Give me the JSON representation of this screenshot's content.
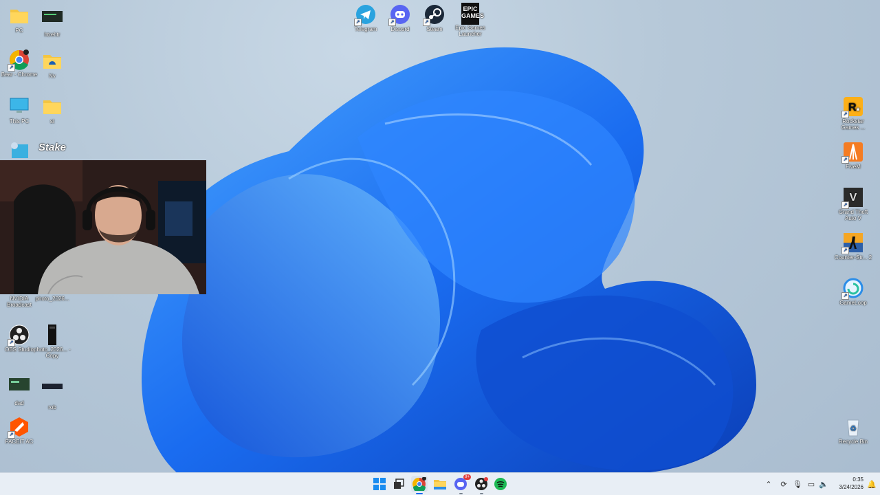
{
  "desktop": {
    "icons_left": [
      {
        "id": "pc",
        "label": "PC"
      },
      {
        "id": "htrehr",
        "label": "htrehtr"
      },
      {
        "id": "chrome",
        "label": "Bear - Chrome"
      },
      {
        "id": "nv",
        "label": "Nv"
      },
      {
        "id": "thispc",
        "label": "This PC"
      },
      {
        "id": "st",
        "label": "st"
      },
      {
        "id": "nvidia",
        "label": "NVIDIA Broadcast"
      },
      {
        "id": "photo1",
        "label": "photo_2026..."
      },
      {
        "id": "obs",
        "label": "OBS Studio"
      },
      {
        "id": "photo2",
        "label": "photo_2026... - Copy"
      },
      {
        "id": "dad",
        "label": "dad"
      },
      {
        "id": "rob",
        "label": "rob"
      },
      {
        "id": "faceit",
        "label": "FACEIT AC"
      }
    ],
    "partial_label": "Stake",
    "icons_top": [
      {
        "id": "telegram",
        "label": "Telegram"
      },
      {
        "id": "discord",
        "label": "Discord"
      },
      {
        "id": "steam",
        "label": "Steam"
      },
      {
        "id": "epic",
        "label": "Epic Games Launcher",
        "logo": "EPIC GAMES"
      }
    ],
    "icons_right": [
      {
        "id": "rockstar",
        "label": "Rockstar Games ..."
      },
      {
        "id": "fivem",
        "label": "FiveM"
      },
      {
        "id": "gta",
        "label": "Grand Theft Auto V"
      },
      {
        "id": "cs2",
        "label": "Counter-Str... 2"
      },
      {
        "id": "gameloop",
        "label": "GameLoop"
      },
      {
        "id": "recycle",
        "label": "Recycle Bin"
      }
    ]
  },
  "taskbar": {
    "apps": [
      "start-icon",
      "task-view-icon",
      "chrome-icon",
      "file-explorer-icon",
      "discord-icon",
      "obs-icon",
      "spotify-icon"
    ],
    "discord_badge": "9+",
    "tray": {
      "time": "0:35",
      "date": "3/24/2026"
    }
  },
  "colors": {
    "accent": "#1a6cf0",
    "taskbar": "#e8eef5"
  }
}
